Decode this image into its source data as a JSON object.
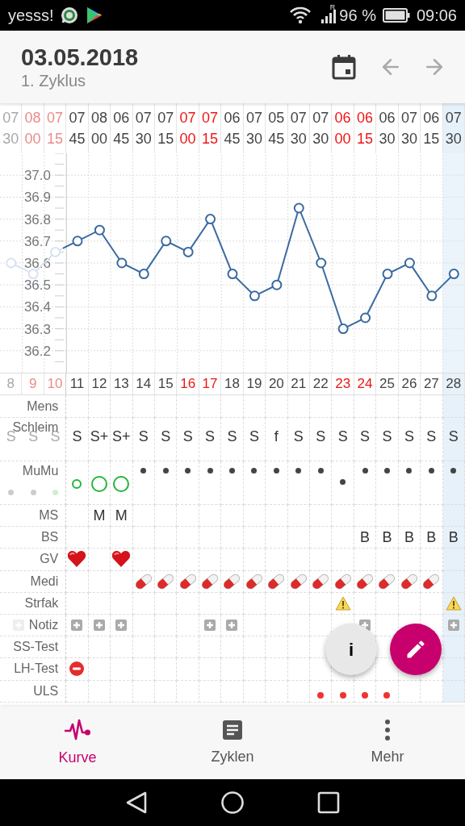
{
  "status_bar": {
    "carrier": "yesss!",
    "roaming": "R",
    "battery": "96 %",
    "time": "09:06"
  },
  "header": {
    "title": "03.05.2018",
    "subtitle": "1. Zyklus"
  },
  "days": [
    {
      "hour": "07",
      "minute": "30",
      "highlight": false,
      "faded": true,
      "selected": false,
      "texts": {
        "schleim": "S"
      },
      "mumu": {
        "kind": "dot-low"
      }
    },
    {
      "hour": "08",
      "minute": "00",
      "highlight": true,
      "faded": true,
      "selected": false,
      "texts": {
        "schleim": "S"
      },
      "mumu": {
        "kind": "dot-low"
      }
    },
    {
      "hour": "07",
      "minute": "15",
      "highlight": true,
      "faded": true,
      "selected": false,
      "texts": {
        "schleim": "S"
      },
      "mumu": {
        "kind": "green-dot-low"
      }
    },
    {
      "hour": "07",
      "minute": "45",
      "highlight": false,
      "faded": false,
      "selected": false,
      "texts": {
        "schleim": "S"
      },
      "mumu": {
        "kind": "ring-small"
      },
      "marks": [
        {
          "kind": "gv"
        },
        {
          "kind": "notiz"
        },
        {
          "kind": "lh_test"
        }
      ]
    },
    {
      "hour": "08",
      "minute": "00",
      "highlight": false,
      "faded": false,
      "selected": false,
      "texts": {
        "schleim": "S+",
        "ms": "M"
      },
      "mumu": {
        "kind": "ring-large"
      },
      "marks": [
        {
          "kind": "notiz"
        }
      ]
    },
    {
      "hour": "06",
      "minute": "45",
      "highlight": false,
      "faded": false,
      "selected": false,
      "texts": {
        "schleim": "S+",
        "ms": "M"
      },
      "mumu": {
        "kind": "ring-large"
      },
      "marks": [
        {
          "kind": "gv"
        },
        {
          "kind": "notiz"
        }
      ]
    },
    {
      "hour": "07",
      "minute": "30",
      "highlight": false,
      "faded": false,
      "selected": false,
      "texts": {
        "schleim": "S"
      },
      "mumu": {
        "kind": "dot"
      },
      "marks": [
        {
          "kind": "medi"
        }
      ]
    },
    {
      "hour": "07",
      "minute": "15",
      "highlight": false,
      "faded": false,
      "selected": false,
      "texts": {
        "schleim": "S"
      },
      "mumu": {
        "kind": "dot"
      },
      "marks": [
        {
          "kind": "medi"
        }
      ]
    },
    {
      "hour": "07",
      "minute": "00",
      "highlight": true,
      "faded": false,
      "selected": false,
      "texts": {
        "schleim": "S"
      },
      "mumu": {
        "kind": "dot"
      },
      "marks": [
        {
          "kind": "medi"
        }
      ]
    },
    {
      "hour": "07",
      "minute": "15",
      "highlight": true,
      "faded": false,
      "selected": false,
      "texts": {
        "schleim": "S"
      },
      "mumu": {
        "kind": "dot"
      },
      "marks": [
        {
          "kind": "medi"
        },
        {
          "kind": "notiz"
        }
      ]
    },
    {
      "hour": "06",
      "minute": "45",
      "highlight": false,
      "faded": false,
      "selected": false,
      "texts": {
        "schleim": "S"
      },
      "mumu": {
        "kind": "dot"
      },
      "marks": [
        {
          "kind": "medi"
        },
        {
          "kind": "notiz"
        }
      ]
    },
    {
      "hour": "07",
      "minute": "30",
      "highlight": false,
      "faded": false,
      "selected": false,
      "texts": {
        "schleim": "S"
      },
      "mumu": {
        "kind": "dot"
      },
      "marks": [
        {
          "kind": "medi"
        }
      ]
    },
    {
      "hour": "05",
      "minute": "45",
      "highlight": false,
      "faded": false,
      "selected": false,
      "texts": {
        "schleim": "f"
      },
      "mumu": {
        "kind": "dot"
      },
      "marks": [
        {
          "kind": "medi"
        }
      ]
    },
    {
      "hour": "07",
      "minute": "30",
      "highlight": false,
      "faded": false,
      "selected": false,
      "texts": {
        "schleim": "S"
      },
      "mumu": {
        "kind": "dot"
      },
      "marks": [
        {
          "kind": "medi"
        }
      ]
    },
    {
      "hour": "07",
      "minute": "30",
      "highlight": false,
      "faded": false,
      "selected": false,
      "texts": {
        "schleim": "S"
      },
      "mumu": {
        "kind": "dot"
      },
      "marks": [
        {
          "kind": "medi"
        },
        {
          "kind": "uls"
        }
      ]
    },
    {
      "hour": "06",
      "minute": "00",
      "highlight": true,
      "faded": false,
      "selected": false,
      "texts": {
        "schleim": "S"
      },
      "mumu": {
        "kind": "dot-low"
      },
      "marks": [
        {
          "kind": "medi"
        },
        {
          "kind": "strfak"
        },
        {
          "kind": "uls"
        }
      ]
    },
    {
      "hour": "06",
      "minute": "15",
      "highlight": true,
      "faded": false,
      "selected": false,
      "texts": {
        "schleim": "S",
        "bs": "B"
      },
      "mumu": {
        "kind": "dot"
      },
      "marks": [
        {
          "kind": "medi"
        },
        {
          "kind": "notiz"
        },
        {
          "kind": "uls"
        }
      ]
    },
    {
      "hour": "06",
      "minute": "30",
      "highlight": false,
      "faded": false,
      "selected": false,
      "texts": {
        "schleim": "S",
        "bs": "B"
      },
      "mumu": {
        "kind": "dot"
      },
      "marks": [
        {
          "kind": "medi"
        },
        {
          "kind": "uls"
        }
      ]
    },
    {
      "hour": "07",
      "minute": "30",
      "highlight": false,
      "faded": false,
      "selected": false,
      "texts": {
        "schleim": "S",
        "bs": "B"
      },
      "mumu": {
        "kind": "dot"
      },
      "marks": [
        {
          "kind": "medi"
        }
      ]
    },
    {
      "hour": "06",
      "minute": "15",
      "highlight": false,
      "faded": false,
      "selected": false,
      "texts": {
        "schleim": "S",
        "bs": "B"
      },
      "mumu": {
        "kind": "dot"
      },
      "marks": [
        {
          "kind": "medi"
        }
      ]
    },
    {
      "hour": "07",
      "minute": "30",
      "highlight": false,
      "faded": false,
      "selected": true,
      "texts": {
        "schleim": "S",
        "bs": "B"
      },
      "mumu": {
        "kind": "dot"
      },
      "marks": [
        {
          "kind": "strfak"
        },
        {
          "kind": "notiz"
        }
      ]
    }
  ],
  "chart_data": {
    "type": "line",
    "grid": true,
    "marker": "o",
    "categories": [
      "8",
      "9",
      "10",
      "11",
      "12",
      "13",
      "14",
      "15",
      "16",
      "17",
      "18",
      "19",
      "20",
      "21",
      "22",
      "23",
      "24",
      "25",
      "26",
      "27",
      "28"
    ],
    "bands": [
      {
        "axis": "x",
        "from": "28",
        "to": "28"
      }
    ],
    "ylim": [
      36.1,
      37.1
    ],
    "yticks": [
      {
        "value": 36.2,
        "label": "36.2"
      },
      {
        "value": 36.3,
        "label": "36.3"
      },
      {
        "value": 36.4,
        "label": "36.4"
      },
      {
        "value": 36.5,
        "label": "36.5"
      },
      {
        "value": 36.6,
        "label": "36.6"
      },
      {
        "value": 36.7,
        "label": "36.7"
      },
      {
        "value": 36.8,
        "label": "36.8"
      },
      {
        "value": 36.9,
        "label": "36.9"
      },
      {
        "value": 37.0,
        "label": "37.0"
      }
    ],
    "series": [
      {
        "color": "#3a6aa0",
        "values": [
          36.6,
          36.55,
          36.65,
          36.7,
          36.75,
          36.6,
          36.55,
          36.7,
          36.65,
          36.8,
          36.55,
          36.45,
          36.5,
          36.85,
          36.6,
          36.3,
          36.35,
          36.55,
          36.6,
          36.45,
          36.55
        ]
      }
    ]
  },
  "rows": [
    {
      "label": "Mens",
      "kind": "mens"
    },
    {
      "label": "Schleim",
      "kind": "schleim"
    },
    {
      "label": "MuMu",
      "kind": "mumu"
    },
    {
      "label": "MS",
      "kind": "ms"
    },
    {
      "label": "BS",
      "kind": "bs"
    },
    {
      "label": "GV",
      "kind": "gv"
    },
    {
      "label": "Medi",
      "kind": "medi"
    },
    {
      "label": "Strfak",
      "kind": "strfak"
    },
    {
      "label": "Notiz",
      "kind": "notiz"
    },
    {
      "label": "SS-Test",
      "kind": "ss_test"
    },
    {
      "label": "LH-Test",
      "kind": "lh_test"
    },
    {
      "label": "ULS",
      "kind": "uls"
    }
  ],
  "info_button": {
    "label": "i"
  },
  "nav": [
    {
      "label": "Kurve",
      "kind": "curve",
      "selected": true
    },
    {
      "label": "Zyklen",
      "kind": "cycles",
      "selected": false
    },
    {
      "label": "Mehr",
      "kind": "more",
      "selected": false
    }
  ]
}
